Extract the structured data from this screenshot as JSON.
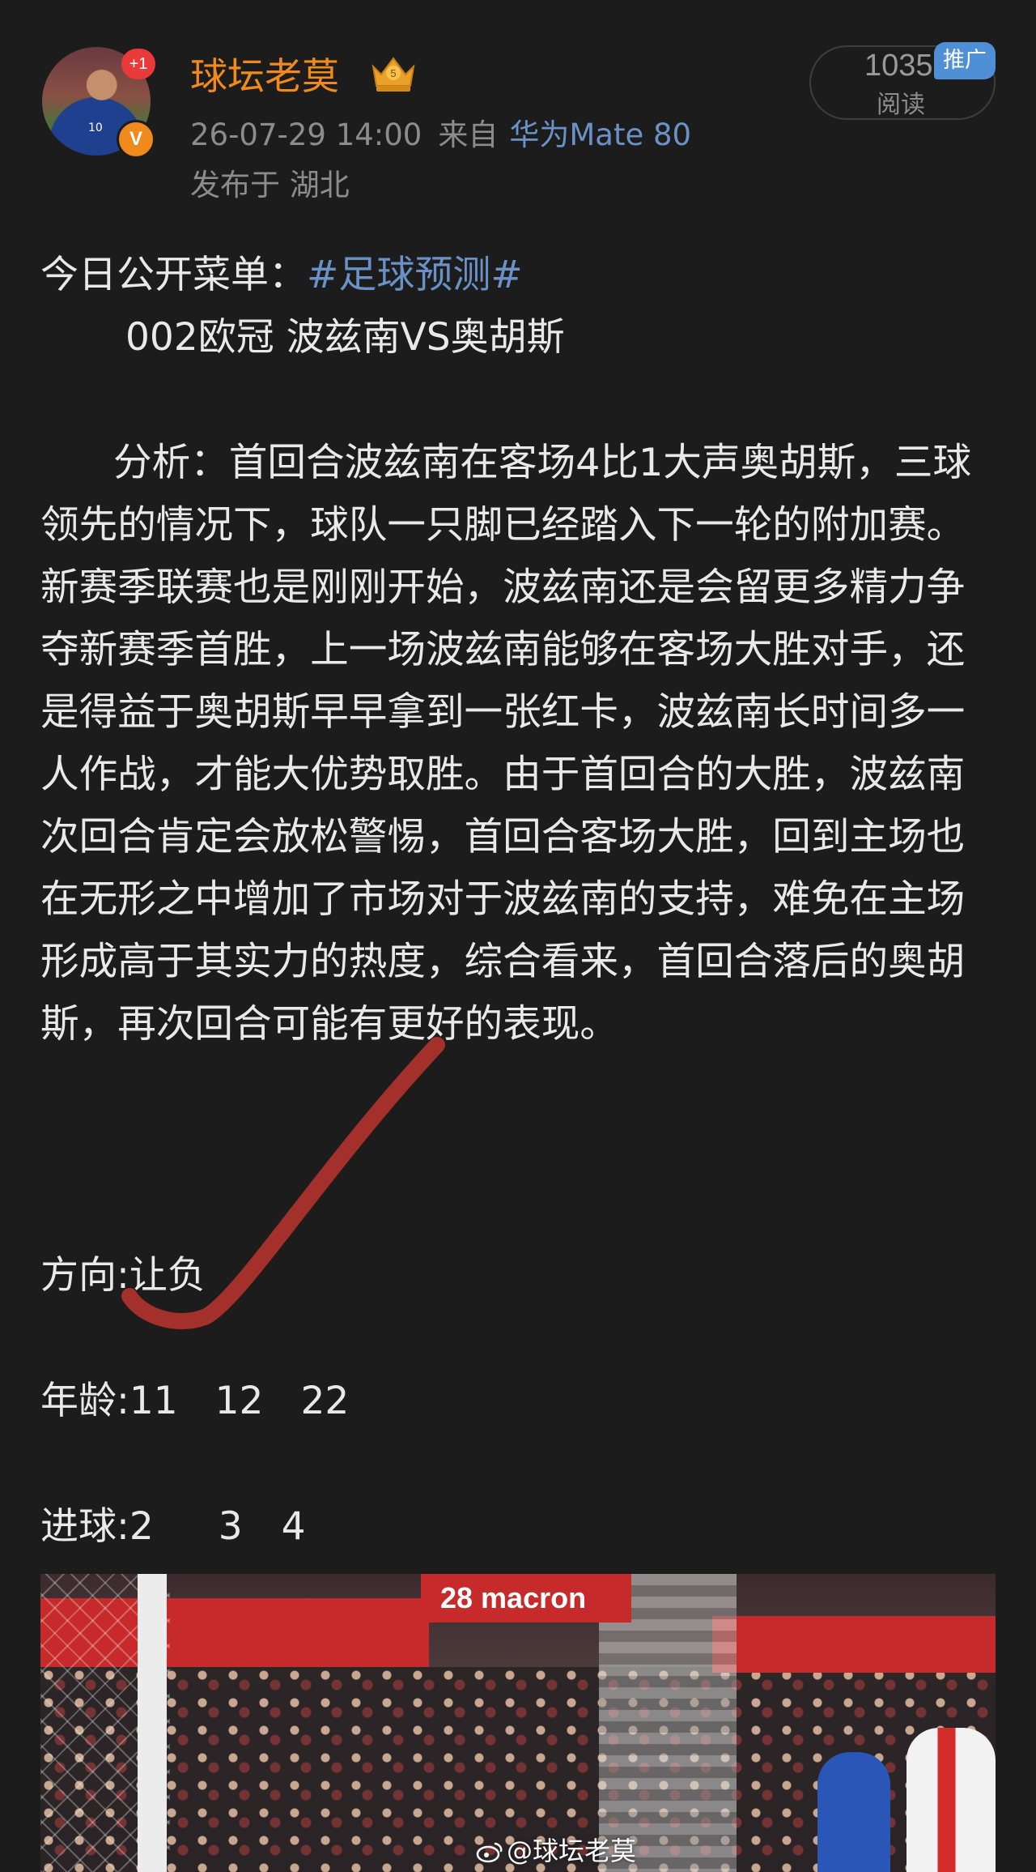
{
  "post": {
    "author": {
      "name": "球坛老莫",
      "notification_badge": "+1",
      "verified_badge": "V",
      "avatar_jersey_number": "10"
    },
    "timestamp": "26-07-29 14:00",
    "source_prefix": "来自",
    "source_device": "华为Mate 80",
    "location": "发布于 湖北",
    "reads": {
      "count": "1035",
      "label": "阅读",
      "promo_tag": "推广"
    },
    "menu_label": "今日公开菜单：",
    "hashtag": "#足球预测#",
    "match_line": "002欧冠 波兹南VS奥胡斯",
    "analysis": "分析：首回合波兹南在客场4比1大声奥胡斯，三球领先的情况下，球队一只脚已经踏入下一轮的附加赛。新赛季联赛也是刚刚开始，波兹南还是会留更多精力争夺新赛季首胜，上一场波兹南能够在客场大胜对手，还是得益于奥胡斯早早拿到一张红卡，波兹南长时间多一人作战，才能大优势取胜。由于首回合的大胜，波兹南次回合肯定会放松警惕，首回合客场大胜，回到主场也在无形之中增加了市场对于波兹南的支持，难免在主场形成高于其实力的热度，综合看来，首回合落后的奥胡斯，再次回合可能有更好的表现。",
    "direction_label": "方向:",
    "direction_value": "让负",
    "age_label": "年龄:",
    "ages": [
      "11",
      "12",
      "22"
    ],
    "goals_label": "进球:",
    "goals": [
      "2",
      "3",
      "4"
    ],
    "image": {
      "scoreboard_text": "28 macron",
      "watermark": "@球坛老莫"
    }
  },
  "colors": {
    "background": "#1c1c1c",
    "username": "#f08a1d",
    "link": "#6b92c7",
    "promo": "#4e8fd6",
    "checkmark": "#a3302b"
  }
}
